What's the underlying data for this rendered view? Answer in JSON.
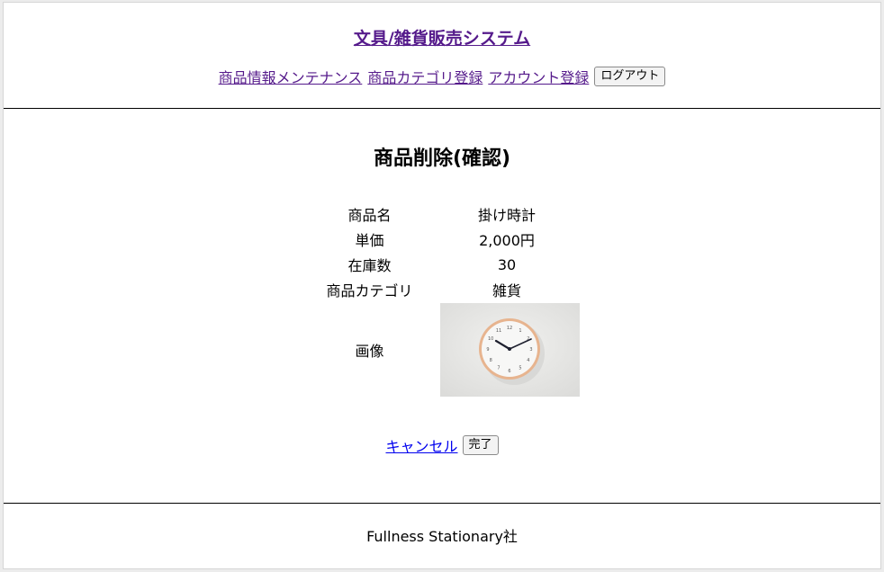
{
  "header": {
    "site_title": "文具/雑貨販売システム",
    "nav": {
      "product_maintenance": "商品情報メンテナンス",
      "category_register": "商品カテゴリ登録",
      "account_register": "アカウント登録",
      "logout": "ログアウト"
    }
  },
  "main": {
    "title": "商品削除(確認)",
    "fields": [
      {
        "label": "商品名",
        "value": "掛け時計"
      },
      {
        "label": "単価",
        "value": "2,000円"
      },
      {
        "label": "在庫数",
        "value": "30"
      },
      {
        "label": "商品カテゴリ",
        "value": "雑貨"
      }
    ],
    "image_label": "画像",
    "image_icon": "wall-clock-photo",
    "clock_numerals": [
      "12",
      "1",
      "2",
      "3",
      "4",
      "5",
      "6",
      "7",
      "8",
      "9",
      "10",
      "11"
    ],
    "cancel": "キャンセル",
    "complete": "完了"
  },
  "footer": {
    "company": "Fullness Stationary社"
  },
  "colors": {
    "visited_link": "#551a8b",
    "link": "#0000ee",
    "clock_frame": "#e7b48f",
    "clock_background": "#e6e6e4"
  }
}
